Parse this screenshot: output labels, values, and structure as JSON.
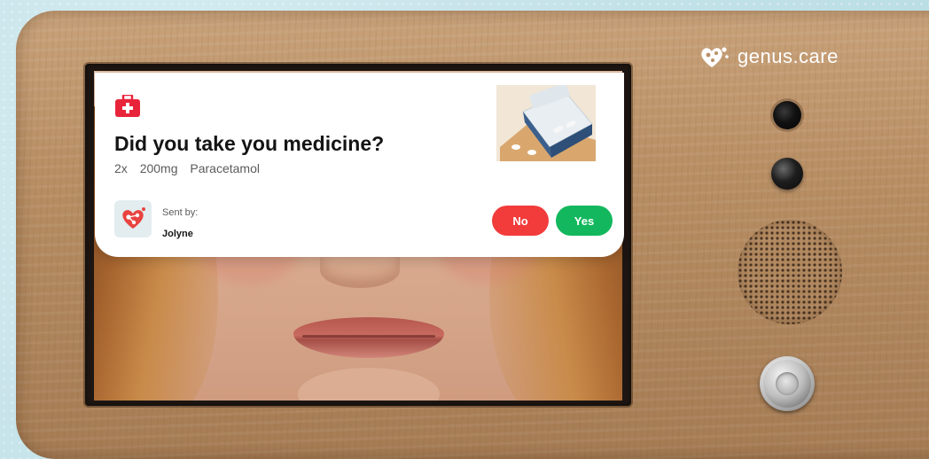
{
  "brand": {
    "name": "genus.care",
    "logo_icon": "heart-network-icon"
  },
  "notification": {
    "icon": "medical-kit-icon",
    "title": "Did you take you medicine?",
    "dose": {
      "count": "2x",
      "amount": "200mg",
      "medicine": "Paracetamol"
    },
    "image": "medicine-package-photo",
    "sender": {
      "label": "Sent by:",
      "name": "Jolyne",
      "avatar_icon": "heart-network-icon"
    },
    "buttons": {
      "no_label": "No",
      "yes_label": "Yes"
    }
  },
  "colors": {
    "accent_red": "#f23b3b",
    "accent_green": "#13b85e",
    "brand_red": "#e8433f",
    "text_dark": "#141414",
    "text_muted": "#5b5b5b"
  }
}
